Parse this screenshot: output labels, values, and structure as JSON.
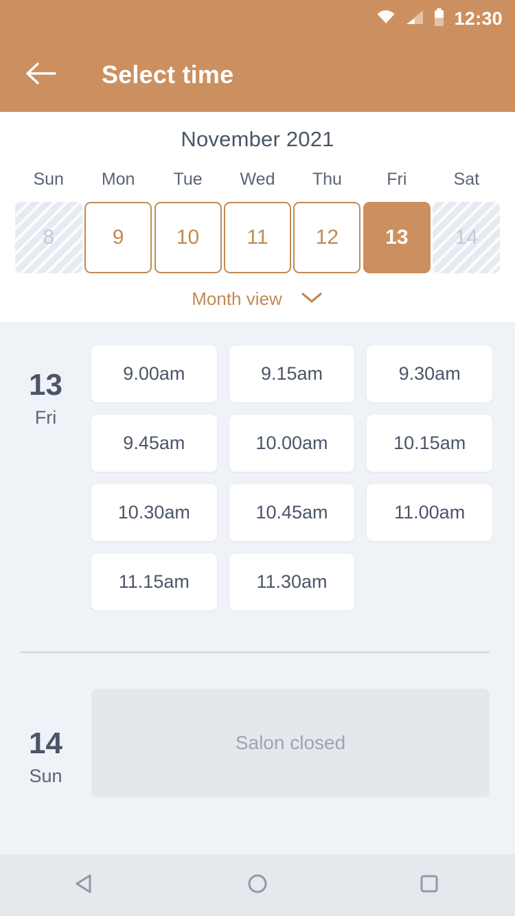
{
  "status_bar": {
    "time": "12:30",
    "icons": [
      "wifi-icon",
      "cellular-signal-icon",
      "battery-icon"
    ]
  },
  "app_bar": {
    "title": "Select time",
    "back_icon": "arrow-left-icon"
  },
  "calendar": {
    "month_title": "November 2021",
    "weekday_headers": [
      "Sun",
      "Mon",
      "Tue",
      "Wed",
      "Thu",
      "Fri",
      "Sat"
    ],
    "days": [
      {
        "number": "8",
        "state": "disabled"
      },
      {
        "number": "9",
        "state": "available"
      },
      {
        "number": "10",
        "state": "available"
      },
      {
        "number": "11",
        "state": "available"
      },
      {
        "number": "12",
        "state": "available"
      },
      {
        "number": "13",
        "state": "selected"
      },
      {
        "number": "14",
        "state": "disabled"
      }
    ],
    "month_view_label": "Month view",
    "month_view_chevron": "chevron-down-icon"
  },
  "schedule": [
    {
      "day_number": "13",
      "day_name": "Fri",
      "closed": false,
      "slots": [
        "9.00am",
        "9.15am",
        "9.30am",
        "9.45am",
        "10.00am",
        "10.15am",
        "10.30am",
        "10.45am",
        "11.00am",
        "11.15am",
        "11.30am"
      ]
    },
    {
      "day_number": "14",
      "day_name": "Sun",
      "closed": true,
      "closed_text": "Salon closed"
    }
  ],
  "nav_bar": {
    "back_icon": "triangle-back-icon",
    "home_icon": "circle-home-icon",
    "recents_icon": "square-recents-icon"
  },
  "colors": {
    "brand": "#CC9060",
    "brand_outline": "#C08A54",
    "text_dark": "#4A5568",
    "text_muted": "#5A6474",
    "background": "#EFF2F7",
    "card": "#FFFFFF",
    "closed_card": "#E4E7EB",
    "disabled_day": "#E6EBF2"
  }
}
